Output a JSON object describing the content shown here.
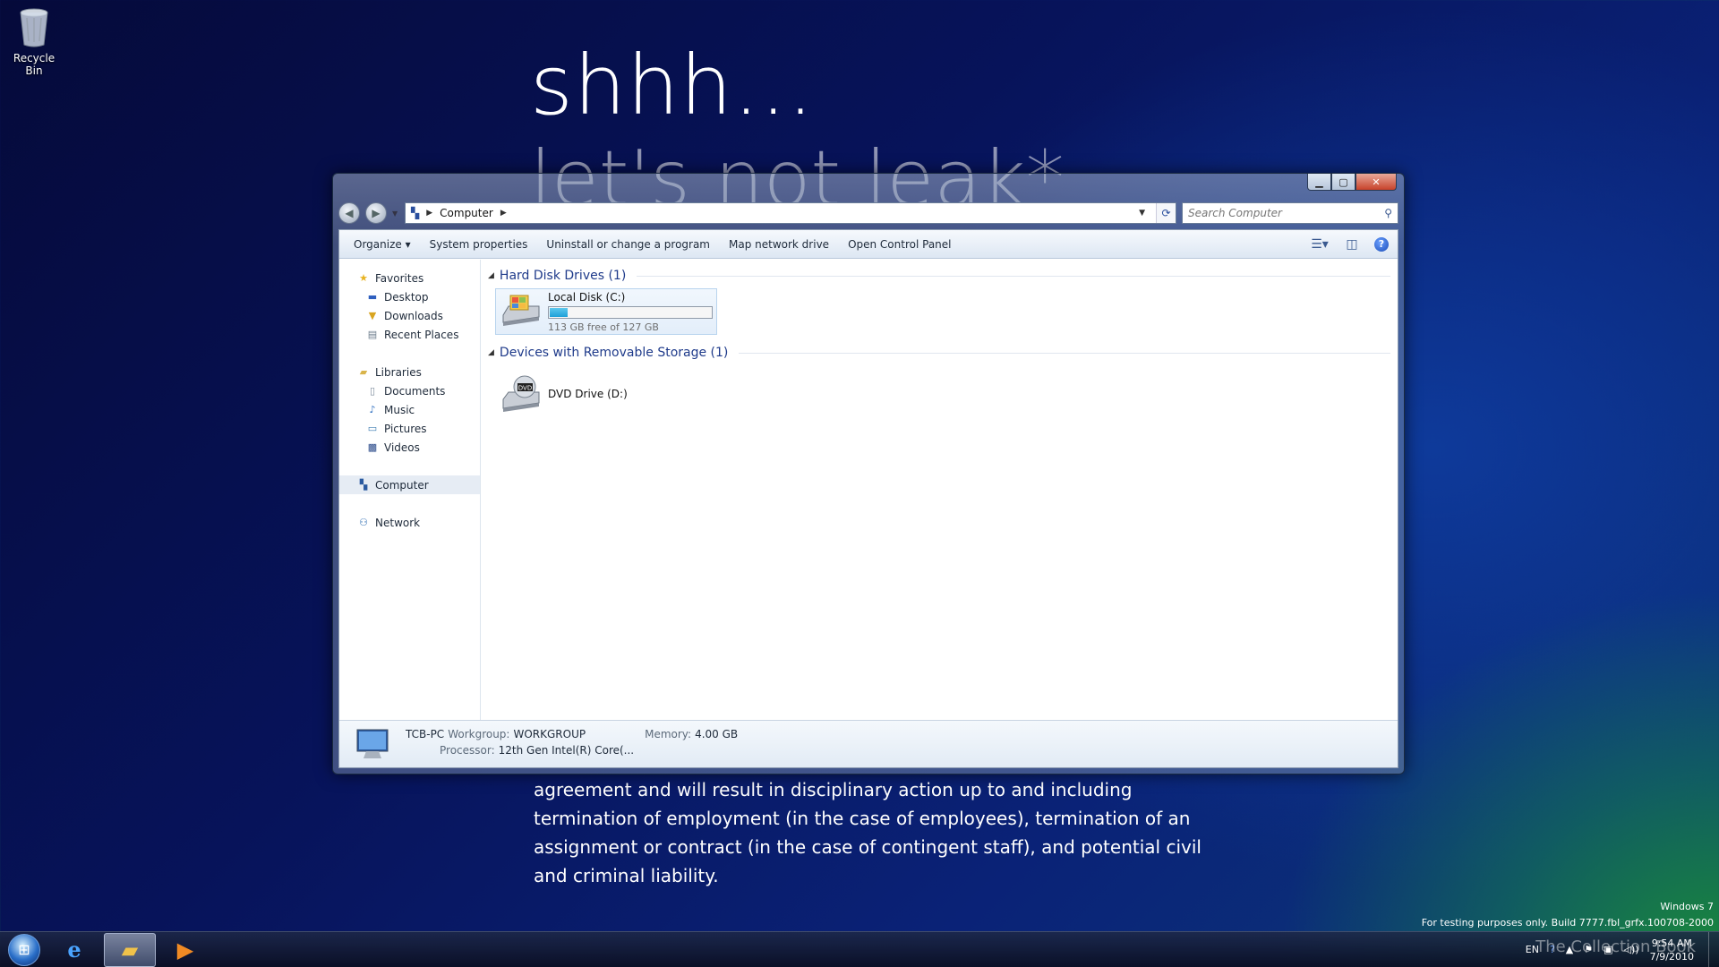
{
  "desktop": {
    "recycle_bin_label": "Recycle Bin"
  },
  "wallpaper": {
    "title": "shhh...",
    "subtitle": "let's not leak*",
    "paragraph": "agreement and will result in disciplinary action up to and including termination of employment (in the case of employees), termination of an assignment or contract (in the case of contingent staff), and potential civil and criminal liability."
  },
  "window": {
    "address_path": "Computer",
    "search_placeholder": "Search Computer",
    "toolbar": {
      "organize": "Organize",
      "system_properties": "System properties",
      "uninstall": "Uninstall or change a program",
      "map_drive": "Map network drive",
      "control_panel": "Open Control Panel"
    },
    "nav": {
      "favorites": "Favorites",
      "desktop": "Desktop",
      "downloads": "Downloads",
      "recent_places": "Recent Places",
      "libraries": "Libraries",
      "documents": "Documents",
      "music": "Music",
      "pictures": "Pictures",
      "videos": "Videos",
      "computer": "Computer",
      "network": "Network"
    },
    "groups": {
      "hard_disks": "Hard Disk Drives (1)",
      "removable": "Devices with Removable Storage (1)"
    },
    "drives": {
      "c_name": "Local Disk (C:)",
      "c_free": "113 GB free of 127 GB",
      "c_used_fraction": 0.11,
      "d_name": "DVD Drive (D:)"
    },
    "details": {
      "pc_name": "TCB-PC",
      "workgroup_label": "Workgroup:",
      "workgroup": "WORKGROUP",
      "memory_label": "Memory:",
      "memory": "4.00 GB",
      "processor_label": "Processor:",
      "processor": "12th Gen Intel(R) Core(..."
    }
  },
  "taskbar": {
    "language": "EN",
    "time": "9:54 AM",
    "date": "7/9/2010"
  },
  "watermark": {
    "line1": "Windows 7",
    "line2": "For testing purposes only. Build 7777.fbl_grfx.100708-2000",
    "tcb": "The Collection Book"
  }
}
